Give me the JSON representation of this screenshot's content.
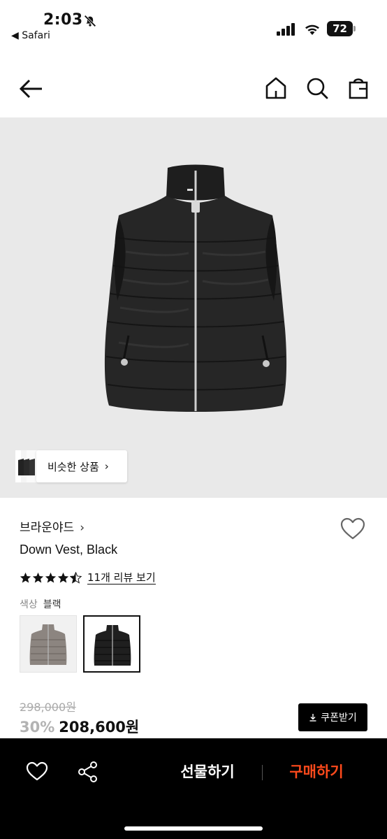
{
  "status_bar": {
    "time": "2:03",
    "back_app": "◀ Safari",
    "battery": "72"
  },
  "hero": {
    "similar_label": "비슷한 상품",
    "similar_chevron": "›"
  },
  "product": {
    "brand": "브라운야드",
    "brand_chevron": "›",
    "name": "Down Vest, Black",
    "rating": 4.5,
    "review_link": "11개 리뷰 보기",
    "color_label": "색상",
    "color_value": "블랙",
    "swatches": [
      {
        "name": "grey",
        "selected": false
      },
      {
        "name": "black",
        "selected": true
      }
    ],
    "original_price": "298,000원",
    "discount": "30%",
    "sale_price": "208,600원",
    "coupon_label": "쿠폰받기",
    "coupon_icon": "download-icon"
  },
  "bottom_bar": {
    "gift_label": "선물하기",
    "buy_label": "구매하기"
  },
  "colors": {
    "buy_accent": "#ff4a1c",
    "hero_bg": "#e9e9e9",
    "bottom_bg": "#000000"
  }
}
